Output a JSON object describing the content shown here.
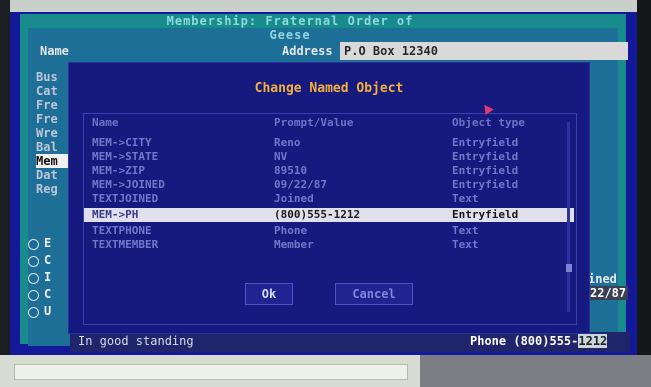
{
  "window": {
    "title": "Membership: Fraternal Order of Geese"
  },
  "form": {
    "name_label": "Name",
    "address_label": "Address",
    "address_value": "P.O Box 12340"
  },
  "background_column": [
    "Bus",
    "Cat",
    "Fre",
    "Fre",
    "Wre",
    "Bal",
    "Mem",
    "Dat",
    "Reg"
  ],
  "radios": [
    {
      "letter": "E"
    },
    {
      "letter": "C"
    },
    {
      "letter": "I"
    },
    {
      "letter": "C"
    },
    {
      "letter": "U"
    }
  ],
  "right_info": {
    "label": "ined",
    "date": "22/87"
  },
  "status": {
    "left_text": "In good standing",
    "right_prefix": "Phone (800)555-",
    "right_highlight": "1212"
  },
  "dialog": {
    "title": "Change Named Object",
    "columns": {
      "name": "Name",
      "prompt": "Prompt/Value",
      "type": "Object type"
    },
    "rows": [
      {
        "name": "MEM->CITY",
        "prompt": "Reno",
        "type": "Entryfield"
      },
      {
        "name": "MEM->STATE",
        "prompt": "NV",
        "type": "Entryfield"
      },
      {
        "name": "MEM->ZIP",
        "prompt": "89510",
        "type": "Entryfield"
      },
      {
        "name": "MEM->JOINED",
        "prompt": "09/22/87",
        "type": "Entryfield"
      },
      {
        "name": "TEXTJOINED",
        "prompt": "Joined",
        "type": "Text"
      },
      {
        "name": "MEM->PH",
        "prompt": "(800)555-1212",
        "type": "Entryfield",
        "selected": true
      },
      {
        "name": "TEXTPHONE",
        "prompt": "Phone",
        "type": "Text"
      },
      {
        "name": "TEXTMEMBER",
        "prompt": "Member",
        "type": "Text"
      }
    ],
    "ok_label": "Ok",
    "cancel_label": "Cancel"
  }
}
